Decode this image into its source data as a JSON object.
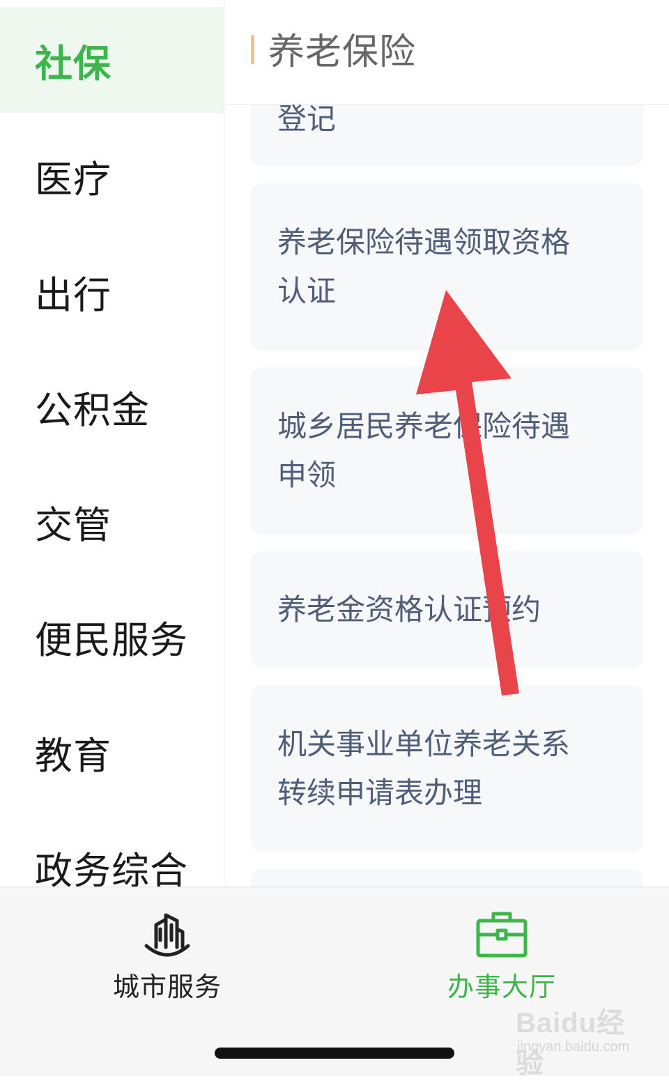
{
  "sidebar": {
    "items": [
      {
        "label": "社保",
        "active": true
      },
      {
        "label": "医疗",
        "active": false
      },
      {
        "label": "出行",
        "active": false
      },
      {
        "label": "公积金",
        "active": false
      },
      {
        "label": "交管",
        "active": false
      },
      {
        "label": "便民服务",
        "active": false
      },
      {
        "label": "教育",
        "active": false
      },
      {
        "label": "政务综合",
        "active": false
      }
    ]
  },
  "section": {
    "title": "养老保险"
  },
  "services": [
    {
      "label": "登记"
    },
    {
      "label": "养老保险待遇领取资格认证"
    },
    {
      "label": "城乡居民养老保险待遇申领"
    },
    {
      "label": "养老金资格认证预约"
    },
    {
      "label": "机关事业单位养老关系转续申请表办理"
    }
  ],
  "tabbar": {
    "city_services": {
      "label": "城市服务",
      "icon": "city-buildings-icon"
    },
    "service_hall": {
      "label": "办事大厅",
      "icon": "briefcase-icon",
      "active": true
    }
  },
  "watermark": {
    "main": "Baidu经验",
    "sub": "jingyan.baidu.com"
  },
  "colors": {
    "accent": "#3cb54a",
    "active_bg": "#eef8ef",
    "header_bar": "#f0c48f",
    "card_bg": "#f7f8fa",
    "card_text": "#4f5d78",
    "annotation_arrow": "#e8444a"
  }
}
